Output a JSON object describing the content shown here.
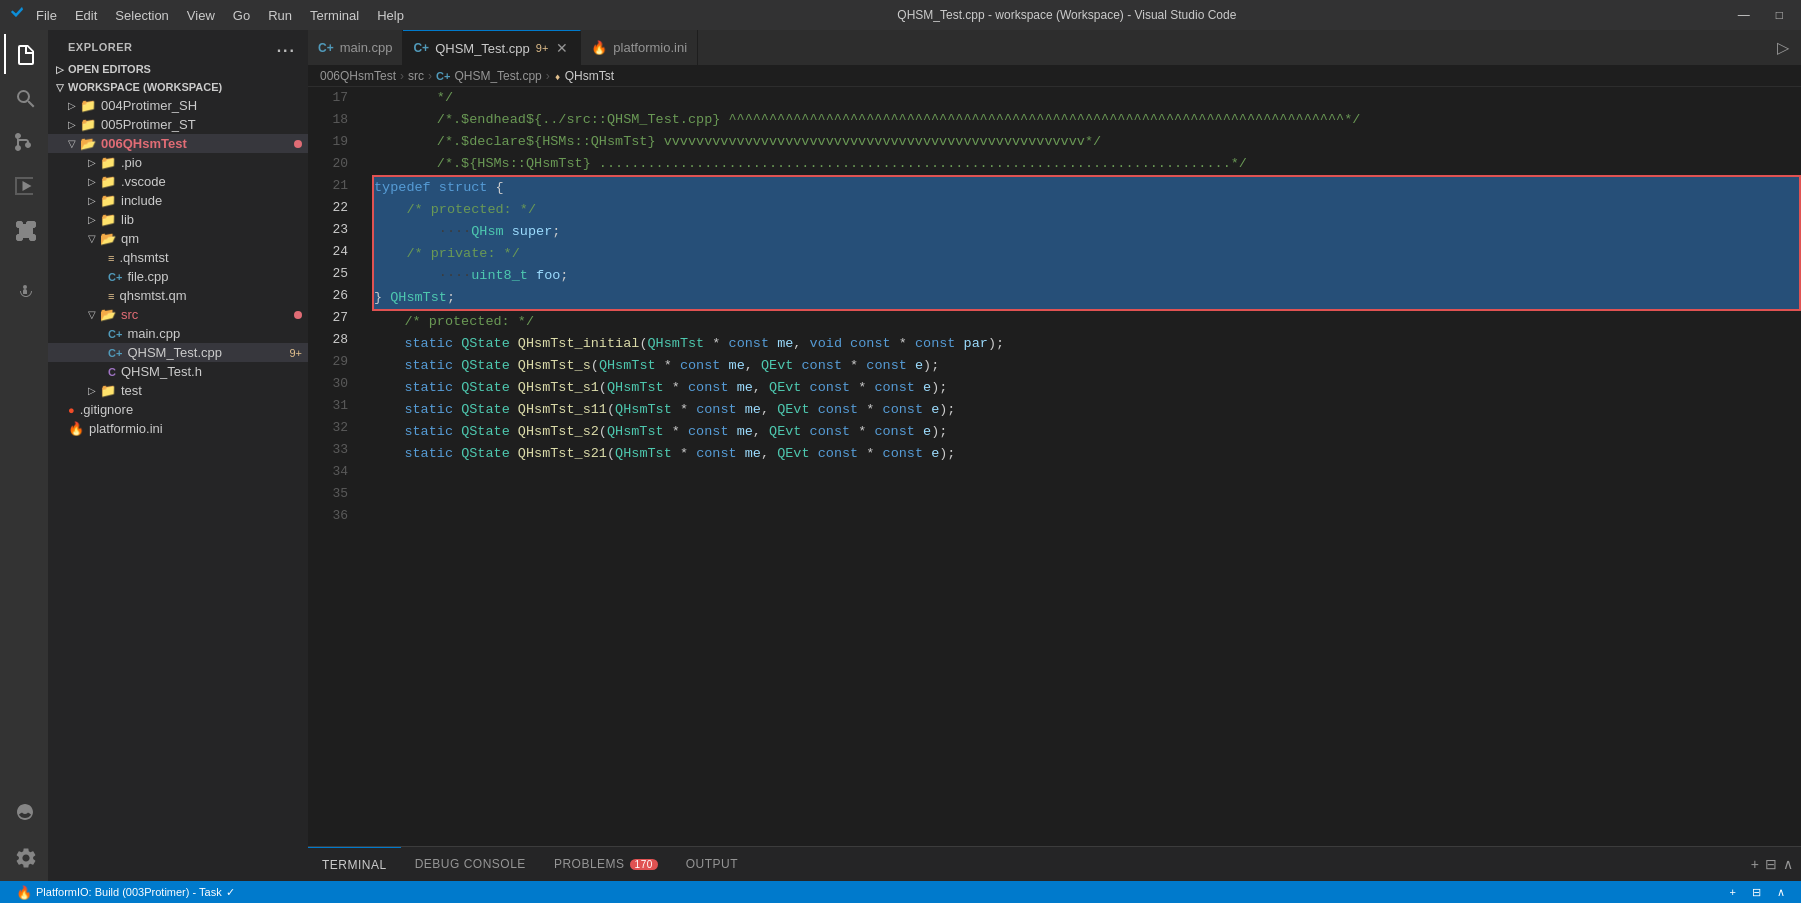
{
  "titlebar": {
    "menu_items": [
      "File",
      "Edit",
      "Selection",
      "View",
      "Go",
      "Run",
      "Terminal",
      "Help"
    ],
    "title": "QHSM_Test.cpp - workspace (Workspace) - Visual Studio Code",
    "vscode_icon": "VS",
    "minimize": "—",
    "maximize": "□"
  },
  "activity_bar": {
    "icons": [
      {
        "name": "explorer-icon",
        "symbol": "⎘",
        "active": true
      },
      {
        "name": "search-icon",
        "symbol": "🔍",
        "active": false
      },
      {
        "name": "source-control-icon",
        "symbol": "⎇",
        "active": false
      },
      {
        "name": "run-icon",
        "symbol": "▷",
        "active": false
      },
      {
        "name": "extensions-icon",
        "symbol": "⊞",
        "active": false
      },
      {
        "name": "robot-icon",
        "symbol": "🤖",
        "active": false
      }
    ],
    "bottom_icons": [
      {
        "name": "account-icon",
        "symbol": "👤"
      },
      {
        "name": "settings-icon",
        "symbol": "⚙"
      }
    ]
  },
  "sidebar": {
    "header": "EXPLORER",
    "more_icon": "...",
    "sections": {
      "open_editors": {
        "label": "OPEN EDITORS",
        "expanded": true
      },
      "workspace": {
        "label": "WORKSPACE (WORKSPACE)",
        "expanded": true,
        "items": [
          {
            "id": "004Protimer_SH",
            "label": "004Protimer_SH",
            "indent": 1,
            "type": "folder",
            "expanded": false
          },
          {
            "id": "005Protimer_ST",
            "label": "005Protimer_ST",
            "indent": 1,
            "type": "folder",
            "expanded": false
          },
          {
            "id": "006QHsmTest",
            "label": "006QHsmTest",
            "indent": 1,
            "type": "folder",
            "expanded": true,
            "active": true,
            "has_dot": true
          },
          {
            "id": "pio",
            "label": ".pio",
            "indent": 2,
            "type": "folder",
            "expanded": false
          },
          {
            "id": "vscode",
            "label": ".vscode",
            "indent": 2,
            "type": "folder",
            "expanded": false
          },
          {
            "id": "include",
            "label": "include",
            "indent": 2,
            "type": "folder",
            "expanded": false
          },
          {
            "id": "lib",
            "label": "lib",
            "indent": 2,
            "type": "folder",
            "expanded": false
          },
          {
            "id": "qm",
            "label": "qm",
            "indent": 2,
            "type": "folder",
            "expanded": true
          },
          {
            "id": "qhsmtst",
            "label": ".qhsmtst",
            "indent": 3,
            "type": "qm"
          },
          {
            "id": "file_cpp",
            "label": "file.cpp",
            "indent": 3,
            "type": "cpp"
          },
          {
            "id": "qhsmtst_qm",
            "label": "qhsmtst.qm",
            "indent": 3,
            "type": "qm"
          },
          {
            "id": "src",
            "label": "src",
            "indent": 2,
            "type": "folder",
            "expanded": true,
            "has_dot": true
          },
          {
            "id": "main_cpp",
            "label": "main.cpp",
            "indent": 3,
            "type": "cpp"
          },
          {
            "id": "QHSM_Test_cpp",
            "label": "QHSM_Test.cpp",
            "indent": 3,
            "type": "cpp",
            "badge": "9+",
            "active": true
          },
          {
            "id": "QHSM_Test_h",
            "label": "QHSM_Test.h",
            "indent": 3,
            "type": "c"
          },
          {
            "id": "test",
            "label": "test",
            "indent": 2,
            "type": "folder",
            "expanded": false
          },
          {
            "id": "gitignore",
            "label": ".gitignore",
            "indent": 1,
            "type": "git"
          },
          {
            "id": "platformio",
            "label": "platformio.ini",
            "indent": 1,
            "type": "ini"
          }
        ]
      }
    }
  },
  "tabs": [
    {
      "id": "main_cpp",
      "label": "main.cpp",
      "icon": "C+",
      "active": false,
      "modified": false
    },
    {
      "id": "QHSM_Test_cpp",
      "label": "QHSM_Test.cpp",
      "icon": "C+",
      "active": true,
      "badge": "9+",
      "modified": true
    },
    {
      "id": "platformio_ini",
      "label": "platformio.ini",
      "icon": "🔥",
      "active": false,
      "modified": false
    }
  ],
  "breadcrumb": {
    "items": [
      "006QHsmTest",
      "src",
      "QHSM_Test.cpp",
      "QHsmTst"
    ]
  },
  "code": {
    "lines": [
      {
        "num": 17,
        "text": "        */",
        "selected": false
      },
      {
        "num": 18,
        "text": "        /*.$endhead${../src::QHSM_Test.cpp} ^^^^^^^^^^^^^^^^^^^^^^^^^^^^^^^^^^^^^^^^^^^^^^^^^^^^^^^^^^^^^^^^^^^^^^^^^^^^^^^^^^^^^^^^^^^^^^^^^^^^^^^^^^^^^^^^^^^^^^^^^^^^^^^^^^^^*/",
        "selected": false
      },
      {
        "num": 19,
        "text": "",
        "selected": false
      },
      {
        "num": 20,
        "text": "        /*.$declare${HSMs::QHsmTst} vvvvvvvvvvvvvvvvvvvvvvvvvvvvvvvvvvvvvvvvvvvvvvvvvvvv*/",
        "selected": false
      },
      {
        "num": 21,
        "text": "        /*.${HSMs::QHsmTst} ..............................................................................*/",
        "selected": false
      },
      {
        "num": 22,
        "text": "typedef struct {",
        "selected": true
      },
      {
        "num": 23,
        "text": "    /* protected: */",
        "selected": true
      },
      {
        "num": 24,
        "text": "        ····QHsm super;",
        "selected": true
      },
      {
        "num": 25,
        "text": "",
        "selected": true
      },
      {
        "num": 26,
        "text": "    /* private: */",
        "selected": true
      },
      {
        "num": 27,
        "text": "        ····uint8_t foo;",
        "selected": true
      },
      {
        "num": 28,
        "text": "} QHsmTst;",
        "selected": true
      },
      {
        "num": 29,
        "text": "",
        "selected": false
      },
      {
        "num": 30,
        "text": "    /* protected: */",
        "selected": false
      },
      {
        "num": 31,
        "text": "    static QState QHsmTst_initial(QHsmTst * const me, void const * const par);",
        "selected": false
      },
      {
        "num": 32,
        "text": "    static QState QHsmTst_s(QHsmTst * const me, QEvt const * const e);",
        "selected": false
      },
      {
        "num": 33,
        "text": "    static QState QHsmTst_s1(QHsmTst * const me, QEvt const * const e);",
        "selected": false
      },
      {
        "num": 34,
        "text": "    static QState QHsmTst_s11(QHsmTst * const me, QEvt const * const e);",
        "selected": false
      },
      {
        "num": 35,
        "text": "    static QState QHsmTst_s2(QHsmTst * const me, QEvt const * const e);",
        "selected": false
      },
      {
        "num": 36,
        "text": "    static QState QHsmTst_s21(QHsmTst * const me, QEvt const * const e);",
        "selected": false
      }
    ]
  },
  "panel_tabs": [
    {
      "id": "terminal",
      "label": "TERMINAL",
      "active": true
    },
    {
      "id": "debug_console",
      "label": "DEBUG CONSOLE",
      "active": false
    },
    {
      "id": "problems",
      "label": "PROBLEMS",
      "badge": "170",
      "active": false
    },
    {
      "id": "output",
      "label": "OUTPUT",
      "active": false
    }
  ],
  "status_bar": {
    "left_items": [
      {
        "id": "branch",
        "label": "⎇ PlatformIO: Build (003Protimer) - Task"
      },
      {
        "id": "check",
        "label": "✓"
      }
    ],
    "right_items": [
      {
        "id": "new_terminal",
        "label": "+"
      },
      {
        "id": "split",
        "label": "⊟"
      },
      {
        "id": "close_panel",
        "label": "∧"
      }
    ]
  },
  "colors": {
    "accent": "#007acc",
    "active_tab_border": "#007acc",
    "modified_dot": "#e2c08d",
    "error_dot": "#e06c75",
    "selected_bg": "#264f78",
    "selected_border": "#e05252"
  }
}
